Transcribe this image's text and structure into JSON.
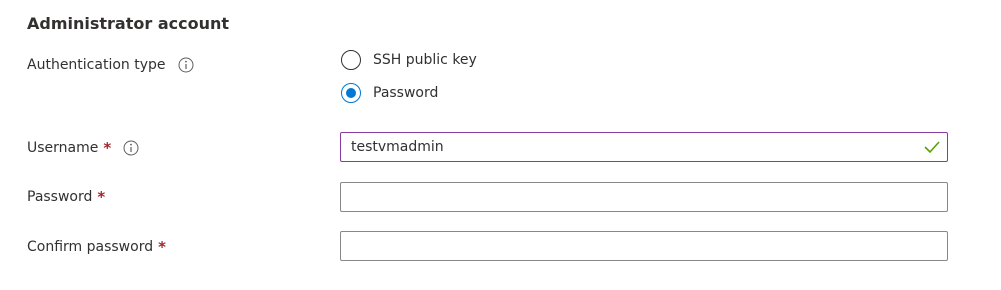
{
  "section": {
    "title": "Administrator account"
  },
  "auth": {
    "label": "Authentication type",
    "info_icon": "info-icon",
    "options": [
      {
        "label": "SSH public key",
        "checked": false
      },
      {
        "label": "Password",
        "checked": true
      }
    ]
  },
  "username": {
    "label": "Username",
    "required_mark": "*",
    "info_icon": "info-icon",
    "value": "testvmadmin",
    "valid_icon": "checkmark-icon"
  },
  "password": {
    "label": "Password",
    "required_mark": "*",
    "value": ""
  },
  "confirm_password": {
    "label": "Confirm password",
    "required_mark": "*",
    "value": ""
  },
  "colors": {
    "accent": "#0078d4",
    "required": "#a4262c",
    "valid": "#57a300",
    "active_border": "#8a3a9e"
  }
}
